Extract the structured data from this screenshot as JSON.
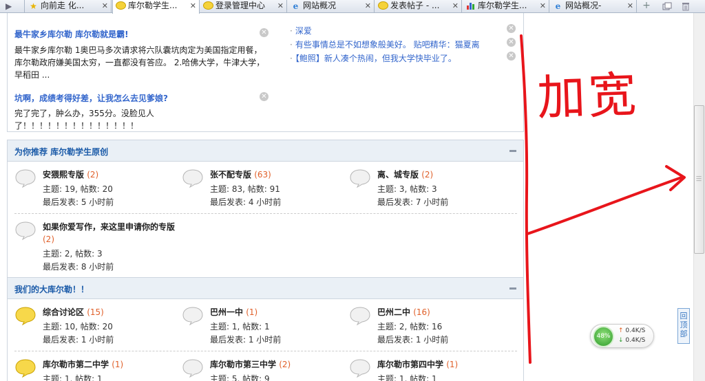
{
  "tabs": [
    {
      "label": "向前走 化...",
      "icon": "star"
    },
    {
      "label": "库尔勒学生...",
      "icon": "bubble",
      "active": true
    },
    {
      "label": "登录管理中心",
      "icon": "bubble"
    },
    {
      "label": "网站概况",
      "icon": "ie"
    },
    {
      "label": "发表帖子 - ...",
      "icon": "bubble"
    },
    {
      "label": "库尔勒学生...",
      "icon": "chart"
    },
    {
      "label": "网站概况-",
      "icon": "ie"
    }
  ],
  "tab_tools": {
    "new_tab": "+"
  },
  "announcements": [
    {
      "title": "最牛家乡库尔勒 库尔勒就是霸!",
      "text": "最牛家乡库尔勒 1奥巴马多次请求将六队囊坑肉定为美国指定用餐，库尔勒政府嫌美国太穷，一直都没有答应。 2.哈佛大学，牛津大学，早稻田 ..."
    },
    {
      "title": "坑啊，成绩考得好差，让我怎么去见爹娘?",
      "text": "完了完了，肿么办，355分。没脸见人了！！！！！！！！！！！！！！"
    }
  ],
  "side_links": [
    "深爱",
    "有些事情总是不如想象般美好。 贴吧精华：猫夏离",
    "【鲍照】新人凑个热闹，但我大学快毕业了。"
  ],
  "sections": [
    {
      "title": "为你推荐 库尔勒学生原创",
      "forums": [
        {
          "name": "安猥熙专版",
          "count": "(2)",
          "topics": "主题: 19, 帖数: 20",
          "last": "最后发表: 5 小时前",
          "highlight": false
        },
        {
          "name": "张不配专版",
          "count": "(63)",
          "topics": "主题: 83, 帖数: 91",
          "last": "最后发表: 4 小时前",
          "highlight": false
        },
        {
          "name": "离、城专版",
          "count": "(2)",
          "topics": "主题: 3, 帖数: 3",
          "last": "最后发表: 7 小时前",
          "highlight": false
        },
        {
          "name": "如果你爱写作，来这里申请你的专版",
          "count": "(2)",
          "topics": "主题: 2, 帖数: 3",
          "last": "最后发表: 8 小时前",
          "highlight": false
        }
      ]
    },
    {
      "title": "我们的大库尔勒！！",
      "forums": [
        {
          "name": "综合讨论区",
          "count": "(15)",
          "topics": "主题: 10, 帖数: 20",
          "last": "最后发表: 1 小时前",
          "highlight": true
        },
        {
          "name": "巴州一中",
          "count": "(1)",
          "topics": "主题: 1, 帖数: 1",
          "last": "最后发表: 1 小时前",
          "highlight": false
        },
        {
          "name": "巴州二中",
          "count": "(16)",
          "topics": "主题: 2, 帖数: 16",
          "last": "最后发表: 1 小时前",
          "highlight": false
        },
        {
          "name": "库尔勒市第二中学",
          "count": "(1)",
          "topics": "主题: 1, 帖数: 1",
          "last": "",
          "highlight": true
        },
        {
          "name": "库尔勒市第三中学",
          "count": "(2)",
          "topics": "主题: 5, 帖数: 9",
          "last": "",
          "highlight": false
        },
        {
          "name": "库尔勒市第四中学",
          "count": "(1)",
          "topics": "主题: 1, 帖数: 1",
          "last": "",
          "highlight": false
        }
      ]
    }
  ],
  "back_to_top": "回顶部",
  "speed_widget": {
    "percent": "48%",
    "up": "0.4K/S",
    "down": "0.4K/S"
  },
  "annotation": {
    "text": "加宽",
    "color": "#e8151b"
  }
}
